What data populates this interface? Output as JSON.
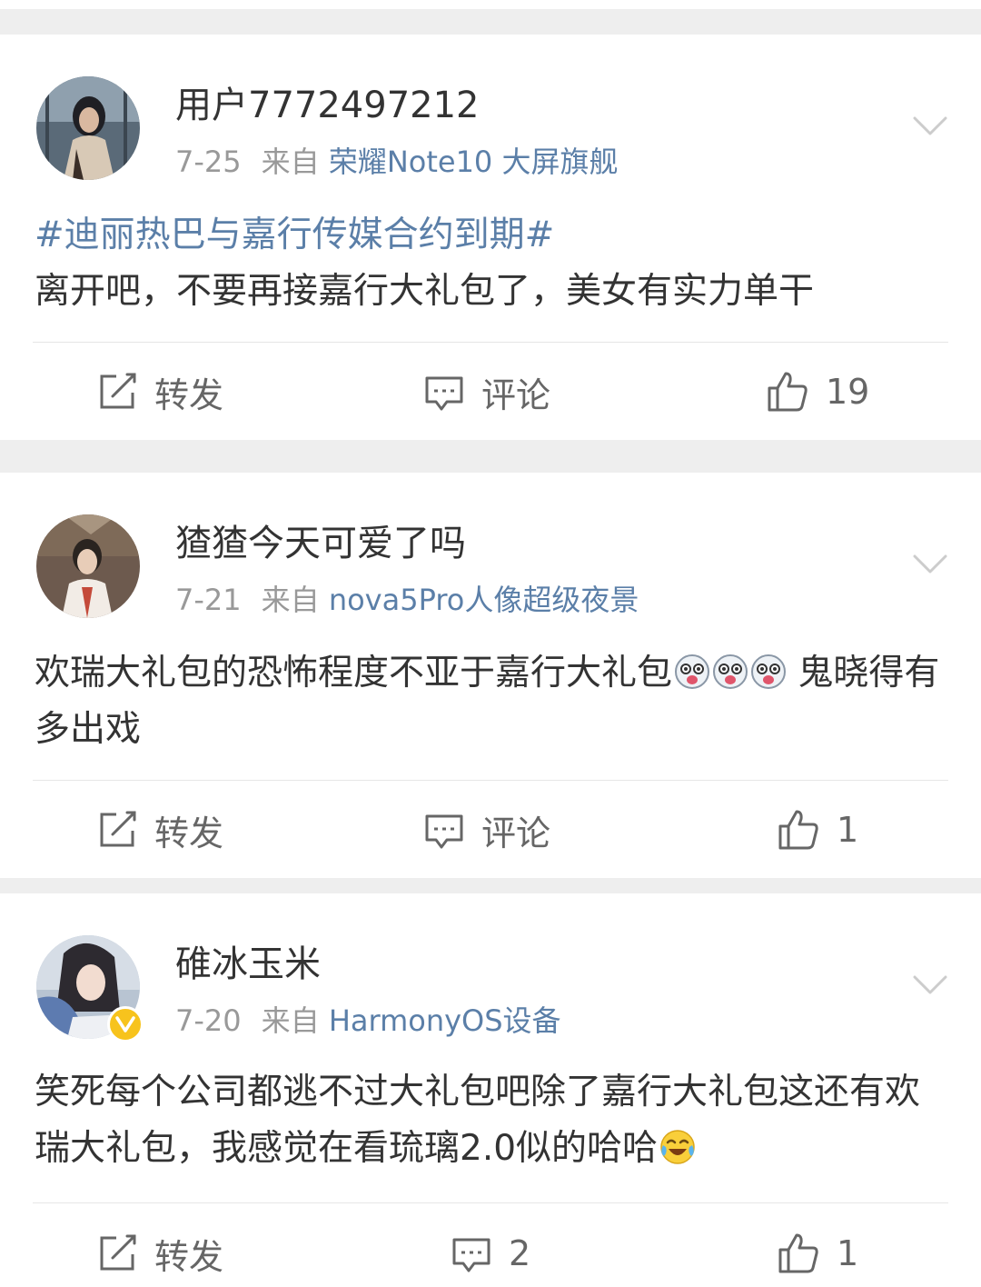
{
  "posts": [
    {
      "username": "用户7772497212",
      "date": "7-25",
      "from_label": "来自",
      "source": "荣耀Note10 大屏旗舰",
      "hashtag": "#迪丽热巴与嘉行传媒合约到期#",
      "text": "离开吧，不要再接嘉行大礼包了，美女有实力单干",
      "actions": {
        "repost_label": "转发",
        "comment_label": "评论",
        "like_count": "19"
      }
    },
    {
      "username": "猹猹今天可爱了吗",
      "date": "7-21",
      "from_label": "来自",
      "source": "nova5Pro人像超级夜景",
      "text_before": "欢瑞大礼包的恐怖程度不亚于嘉行大礼包",
      "emojis": [
        "doge-emoji",
        "doge-emoji",
        "doge-emoji"
      ],
      "text_after": " 鬼晓得有多出戏",
      "actions": {
        "repost_label": "转发",
        "comment_label": "评论",
        "like_count": "1"
      }
    },
    {
      "username": "碓冰玉米",
      "verified_badge": "v-icon",
      "date": "7-20",
      "from_label": "来自",
      "source": "HarmonyOS设备",
      "text": "笑死每个公司都逃不过大礼包吧除了嘉行大礼包这还有欢瑞大礼包，我感觉在看琉璃2.0似的哈哈",
      "emoji": "laugh-cry-emoji",
      "actions": {
        "repost_label": "转发",
        "comment_count": "2",
        "like_count": "1"
      }
    }
  ],
  "colors": {
    "link": "#5b7fa8",
    "meta": "#999999",
    "text": "#333333",
    "background": "#eeeeee",
    "card": "#ffffff",
    "badge": "#f7c31d"
  }
}
